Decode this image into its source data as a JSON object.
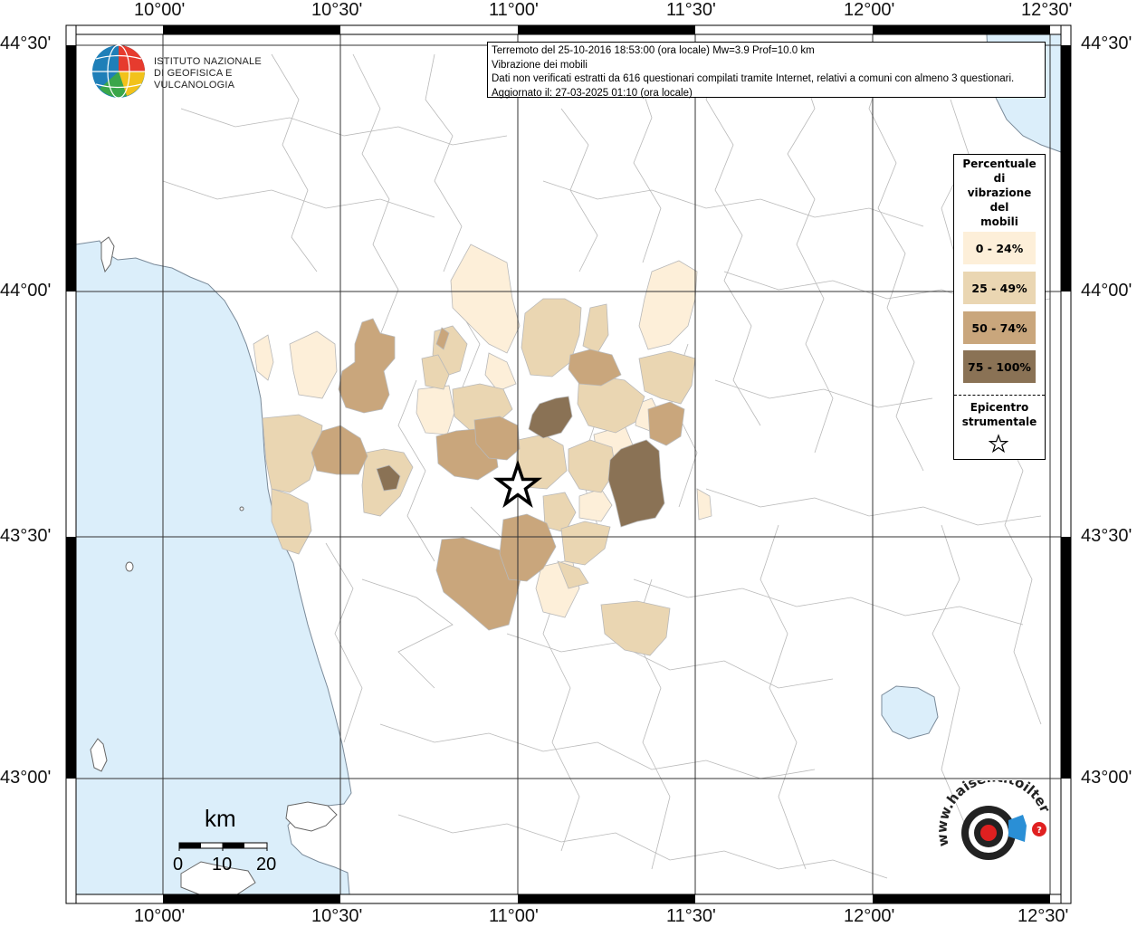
{
  "map": {
    "lon_labels": [
      "10°00'",
      "10°30'",
      "11°00'",
      "11°30'",
      "12°00'",
      "12°30'"
    ],
    "lat_labels": [
      "44°30'",
      "44°00'",
      "43°30'",
      "43°00'"
    ],
    "colors": {
      "sea": "#dbeefa",
      "land": "#ffffff",
      "border": "#b4b4b4",
      "class_0_24": "#fdefd9",
      "class_25_49": "#ead6b2",
      "class_50_74": "#c9a67c",
      "class_75_100": "#8a7255"
    }
  },
  "institute": {
    "line1": "ISTITUTO NAZIONALE",
    "line2": "DI GEOFISICA E VULCANOLOGIA"
  },
  "info": {
    "line1": "Terremoto del 25-10-2016 18:53:00 (ora locale) Mw=3.9 Prof=10.0 km",
    "line2": "Vibrazione dei mobili",
    "line3": "Dati non verificati estratti da 616 questionari compilati tramite Internet, relativi a comuni con almeno 3 questionari.",
    "line4": "Aggiornato il: 27-03-2025 01:10 (ora locale)"
  },
  "legend": {
    "title_lines": [
      "Percentuale",
      "di",
      "vibrazione",
      "del",
      "mobili"
    ],
    "classes": [
      {
        "label": "0 - 24%",
        "color": "#fdefd9"
      },
      {
        "label": "25 - 49%",
        "color": "#ead6b2"
      },
      {
        "label": "50 - 74%",
        "color": "#c9a67c"
      },
      {
        "label": "75 - 100%",
        "color": "#8a7255"
      }
    ],
    "epicenter_lines": [
      "Epicentro",
      "strumentale"
    ],
    "epicenter_symbol": "star-icon"
  },
  "scale": {
    "unit": "km",
    "ticks": [
      "0",
      "10",
      "20"
    ]
  },
  "hst_logo": {
    "text": "www.haisentitoilterremoto.it"
  }
}
